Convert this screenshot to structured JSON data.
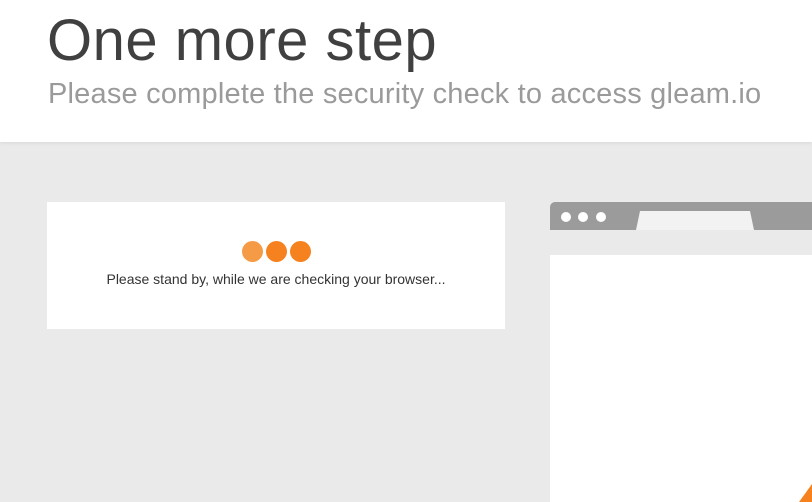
{
  "header": {
    "title": "One more step",
    "subtitle": "Please complete the security check to access gleam.io"
  },
  "status_card": {
    "message": "Please stand by, while we are checking your browser...",
    "loading_dot_colors": [
      "#f69b45",
      "#f6821f",
      "#f6821f"
    ]
  },
  "colors": {
    "accent": "#f6821f",
    "page_background": "#eaeaea",
    "browser_chrome": "#9b9b9b"
  }
}
